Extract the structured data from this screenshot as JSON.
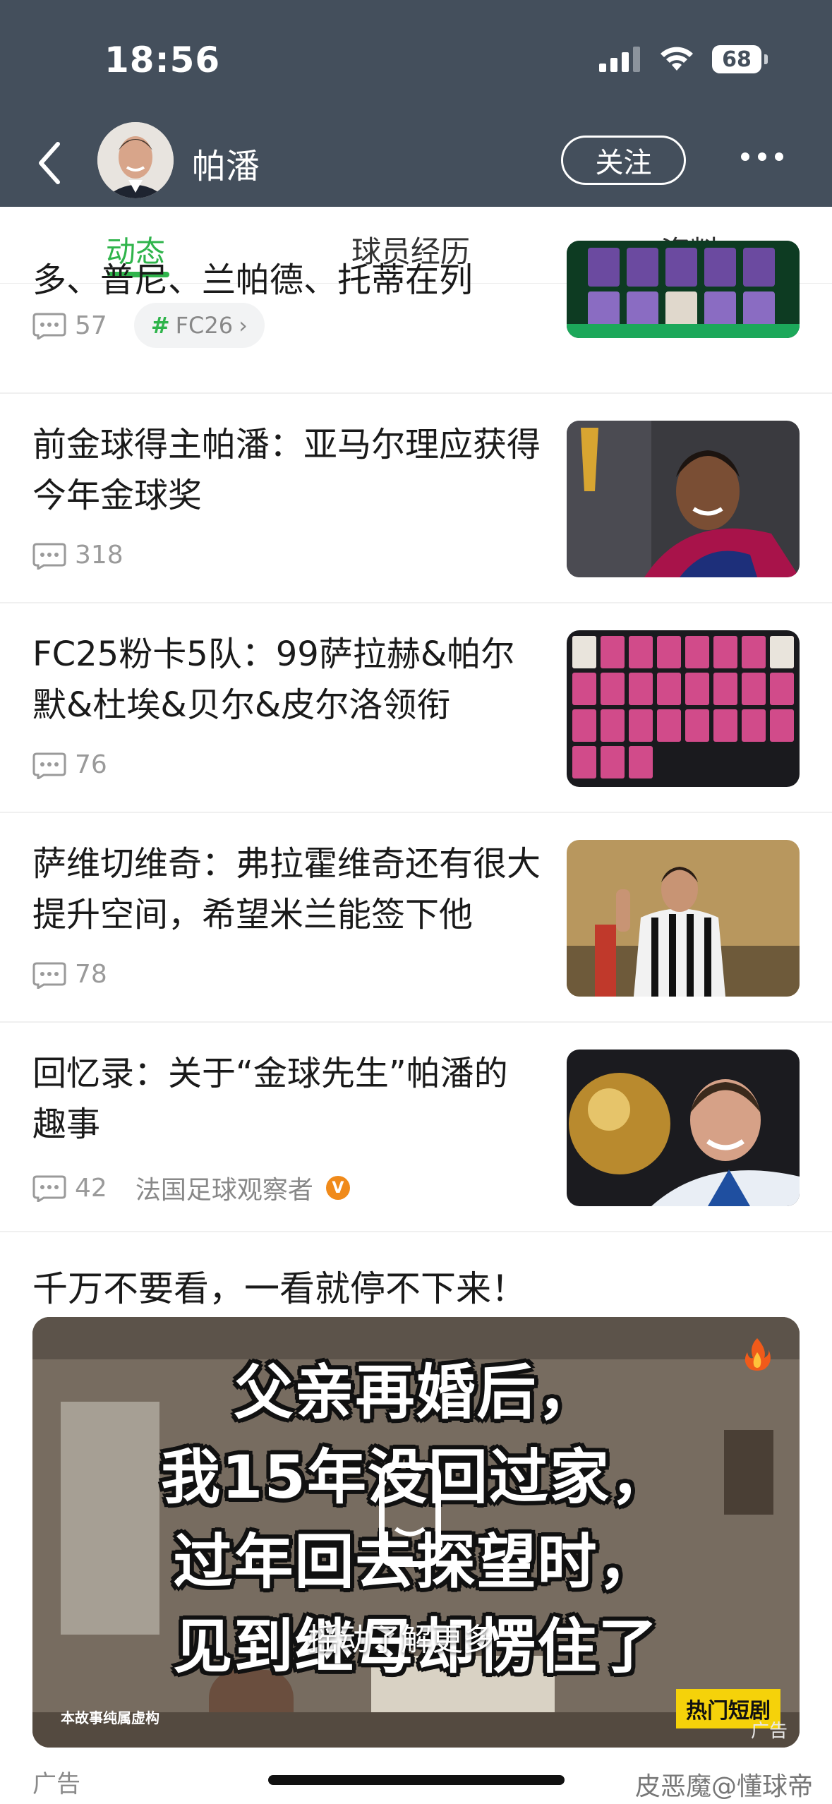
{
  "status_bar": {
    "time": "18:56",
    "battery": "68"
  },
  "header": {
    "name": "帕潘",
    "follow_label": "关注"
  },
  "tabs": [
    {
      "label": "动态",
      "active": true
    },
    {
      "label": "球员经历",
      "active": false
    },
    {
      "label": "资料",
      "active": false
    }
  ],
  "feed": [
    {
      "title": "多、普尼、兰帕德、托蒂在列",
      "comments": "57",
      "tag": "FC26"
    },
    {
      "title": "前金球得主帕潘：亚马尔理应获得今年金球奖",
      "comments": "318"
    },
    {
      "title": "FC25粉卡5队：99萨拉赫&帕尔默&杜埃&贝尔&皮尔洛领衔",
      "comments": "76"
    },
    {
      "title": "萨维切维奇：弗拉霍维奇还有很大提升空间，希望米兰能签下他",
      "comments": "78"
    },
    {
      "title": "回忆录：关于“金球先生”帕潘的趣事",
      "comments": "42",
      "source": "法国足球观察者",
      "verified_mark": "V"
    }
  ],
  "ad": {
    "title": "千万不要看，一看就停不下来！",
    "caption_lines": [
      "父亲再婚后，",
      "我15年没回过家，",
      "过年回去探望时，",
      "见到继母却愣住了"
    ],
    "shake_text": "摇动了解更多",
    "disclaimer": "本故事纯属虚构",
    "hot_badge": "热门短剧",
    "ad_small": "广告",
    "label": "广告"
  },
  "watermark": "皮恶魔@懂球帝",
  "colors": {
    "header_bg": "#444f5c",
    "accent": "#2fb44b",
    "verified": "#f08a1a"
  }
}
